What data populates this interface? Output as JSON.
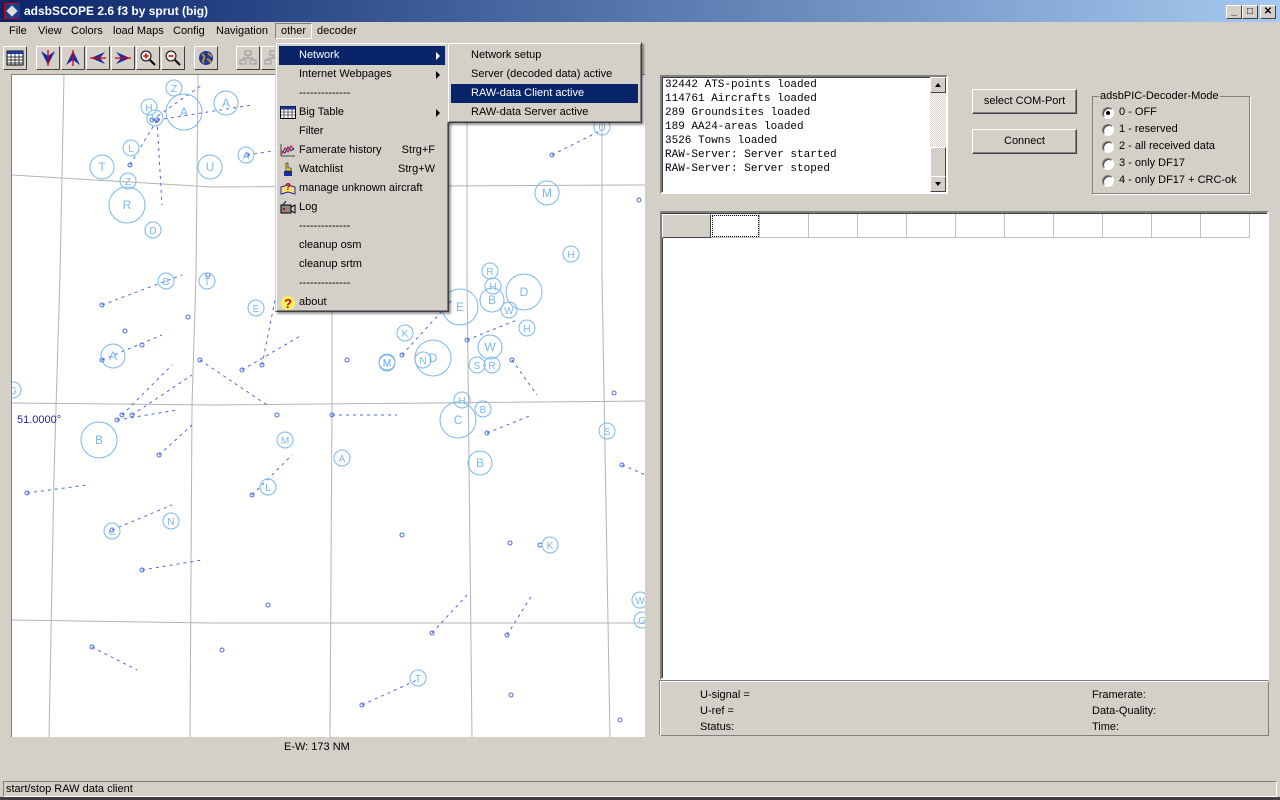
{
  "window": {
    "title": "adsbSCOPE 2.6 f3 by sprut  (big)",
    "controls": {
      "minimize": "_",
      "maximize": "□",
      "close": "✕"
    }
  },
  "menubar": [
    {
      "label": "File"
    },
    {
      "label": "View"
    },
    {
      "label": "Colors"
    },
    {
      "label": "load Maps"
    },
    {
      "label": "Config"
    },
    {
      "label": "Navigation"
    },
    {
      "label": "other",
      "open": true
    },
    {
      "label": "decoder"
    }
  ],
  "toolbar": [
    {
      "icon": "table-icon"
    },
    {
      "icon": "arrow-down-icon"
    },
    {
      "icon": "arrow-up-icon"
    },
    {
      "icon": "arrow-left-icon"
    },
    {
      "icon": "arrow-right-icon"
    },
    {
      "icon": "zoom-in-icon"
    },
    {
      "icon": "zoom-out-icon"
    },
    {
      "icon": "globe-icon"
    },
    {
      "icon": "network-icon"
    },
    {
      "icon": "network-icon"
    }
  ],
  "other_menu": {
    "items": [
      {
        "label": "Network",
        "submenu": true,
        "highlighted": true
      },
      {
        "label": "Internet Webpages",
        "submenu": true
      },
      {
        "label": "--------------",
        "separator": true
      },
      {
        "label": "Big Table",
        "submenu": true,
        "icon": "table-icon"
      },
      {
        "label": "Filter"
      },
      {
        "label": "Famerate history",
        "shortcut": "Strg+F",
        "icon": "chart-icon"
      },
      {
        "label": "Watchlist",
        "shortcut": "Strg+W",
        "icon": "hand-icon"
      },
      {
        "label": "manage unknown aircraft",
        "icon": "question-book-icon"
      },
      {
        "label": "Log",
        "icon": "camera-icon"
      },
      {
        "label": "--------------",
        "separator": true
      },
      {
        "label": "cleanup osm"
      },
      {
        "label": "cleanup srtm"
      },
      {
        "label": "--------------",
        "separator": true
      },
      {
        "label": "about",
        "icon": "help-icon"
      }
    ]
  },
  "network_submenu": {
    "items": [
      {
        "label": "Network setup"
      },
      {
        "label": "Server (decoded data) active"
      },
      {
        "label": "RAW-data Client active",
        "highlighted": true
      },
      {
        "label": "RAW-data Server active"
      }
    ]
  },
  "map": {
    "latitude_label": "51.0000°",
    "ew_label": "E-W: 173 NM",
    "grid_color": "#b4b4b4",
    "symbol_color": "#7ab8f0",
    "track_color": "#4a6ae0",
    "waypoints": [
      {
        "l": "Z",
        "s": "s"
      },
      {
        "l": "A",
        "s": "l"
      },
      {
        "l": "A",
        "s": "m"
      },
      {
        "l": "H",
        "s": "s"
      },
      {
        "l": "H",
        "s": "s"
      },
      {
        "l": "L",
        "s": "s"
      },
      {
        "l": "T",
        "s": "m"
      },
      {
        "l": "U",
        "s": "m"
      },
      {
        "l": "A",
        "s": "s"
      },
      {
        "l": "Z",
        "s": "s"
      },
      {
        "l": "R",
        "s": "l"
      },
      {
        "l": "D",
        "s": "s"
      },
      {
        "l": "B",
        "s": "s"
      },
      {
        "l": "T",
        "s": "s"
      },
      {
        "l": "E",
        "s": "s"
      },
      {
        "l": "A",
        "s": "m"
      },
      {
        "l": "G",
        "s": "s"
      },
      {
        "l": "B",
        "s": "l"
      },
      {
        "l": "M",
        "s": "s"
      },
      {
        "l": "M",
        "s": "s"
      },
      {
        "l": "A",
        "s": "s"
      },
      {
        "l": "L",
        "s": "s"
      },
      {
        "l": "C",
        "s": "s"
      },
      {
        "l": "N",
        "s": "s"
      },
      {
        "l": "K",
        "s": "s"
      },
      {
        "l": "M",
        "s": "s"
      },
      {
        "l": "N",
        "s": "s"
      },
      {
        "l": "D",
        "s": "l"
      },
      {
        "l": "G",
        "s": "m"
      },
      {
        "l": "E",
        "s": "l"
      },
      {
        "l": "R",
        "s": "s"
      },
      {
        "l": "H",
        "s": "s"
      },
      {
        "l": "B",
        "s": "m"
      },
      {
        "l": "D",
        "s": "l"
      },
      {
        "l": "W",
        "s": "s"
      },
      {
        "l": "H",
        "s": "s"
      },
      {
        "l": "W",
        "s": "m"
      },
      {
        "l": "S",
        "s": "s"
      },
      {
        "l": "R",
        "s": "s"
      },
      {
        "l": "H",
        "s": "s"
      },
      {
        "l": "C",
        "s": "l"
      },
      {
        "l": "B",
        "s": "s"
      },
      {
        "l": "B",
        "s": "m"
      },
      {
        "l": "S",
        "s": "s"
      },
      {
        "l": "M",
        "s": "m"
      },
      {
        "l": "H",
        "s": "s"
      },
      {
        "l": "U",
        "s": "s"
      },
      {
        "l": "K",
        "s": "s"
      },
      {
        "l": "T",
        "s": "s"
      },
      {
        "l": "W",
        "s": "s"
      },
      {
        "l": "G",
        "s": "s"
      }
    ]
  },
  "log": {
    "lines": [
      "32442 ATS-points loaded",
      "114761 Aircrafts loaded",
      "289 Groundsites loaded",
      "189 AA24-areas loaded",
      "3526 Towns loaded",
      "RAW-Server: Server started",
      "RAW-Server: Server stoped"
    ]
  },
  "buttons": {
    "select_com_port": "select COM-Port",
    "connect": "Connect"
  },
  "decoder_mode": {
    "title": "adsbPIC-Decoder-Mode",
    "options": [
      {
        "label": "0 - OFF",
        "selected": true
      },
      {
        "label": "1 - reserved",
        "selected": false
      },
      {
        "label": "2 - all received data",
        "selected": false
      },
      {
        "label": "3 - only DF17",
        "selected": false
      },
      {
        "label": "4 - only DF17 + CRC-ok",
        "selected": false
      }
    ]
  },
  "info": {
    "u_signal": "U-signal =",
    "u_ref": "U-ref =",
    "status": "Status:",
    "framerate": "Framerate:",
    "data_quality": "Data-Quality:",
    "time": "Time:"
  },
  "statusbar": {
    "text": "start/stop RAW data client"
  }
}
